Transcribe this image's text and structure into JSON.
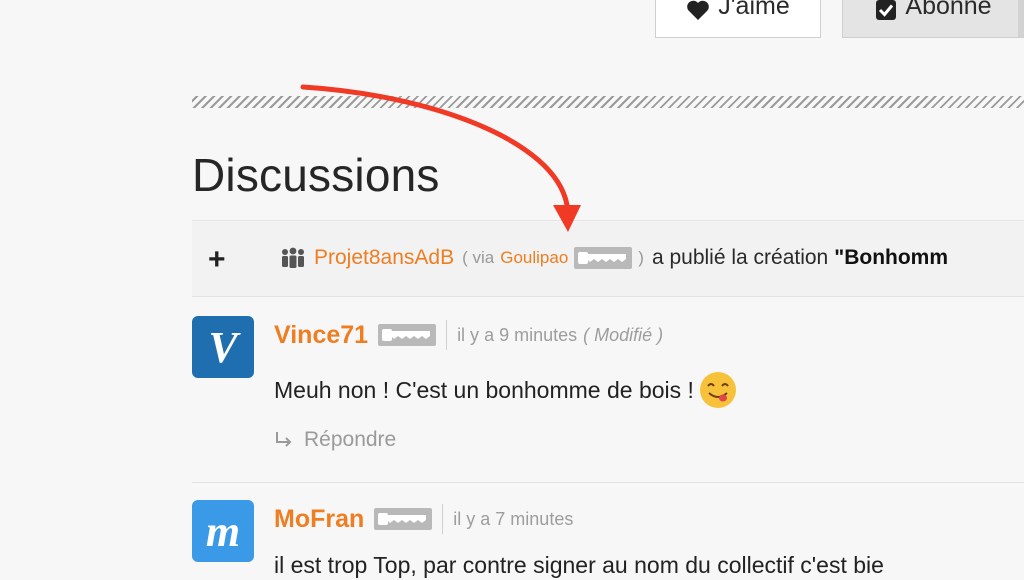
{
  "top_buttons": {
    "like_label": "J'aime",
    "subscribe_label": "Abonné"
  },
  "discussions": {
    "title": "Discussions",
    "activity": {
      "author": "Projet8ansAdB",
      "via_prefix": "( via",
      "via_user": "Goulipao",
      "via_suffix": ")",
      "action_text": "a publié la création",
      "creation_title": "\"Bonhomm"
    },
    "comments": [
      {
        "author": "Vince71",
        "time": "il y a 9 minutes",
        "edited": "( Modifié )",
        "text": "Meuh non ! C'est un bonhomme de bois !",
        "avatar_letter": "V",
        "avatar_color": "#1f6fb0",
        "reply_label": "Répondre"
      },
      {
        "author": "MoFran",
        "time": "il y a 7 minutes",
        "text": "il est trop Top, par contre signer au nom du collectif c'est bie",
        "avatar_letter": "m",
        "avatar_color": "#3b9ae8"
      }
    ]
  },
  "colors": {
    "accent_orange": "#ef7d21",
    "annotation_arrow": "#f03a26",
    "muted_text": "#9d9d9d"
  },
  "icons": {
    "like": "heart-icon",
    "subscribe": "checkbox-checked-icon",
    "group": "group-icon",
    "badge": "saw-badge-icon",
    "reply": "reply-arrow-icon",
    "emoji": "yum-face-emoji"
  }
}
